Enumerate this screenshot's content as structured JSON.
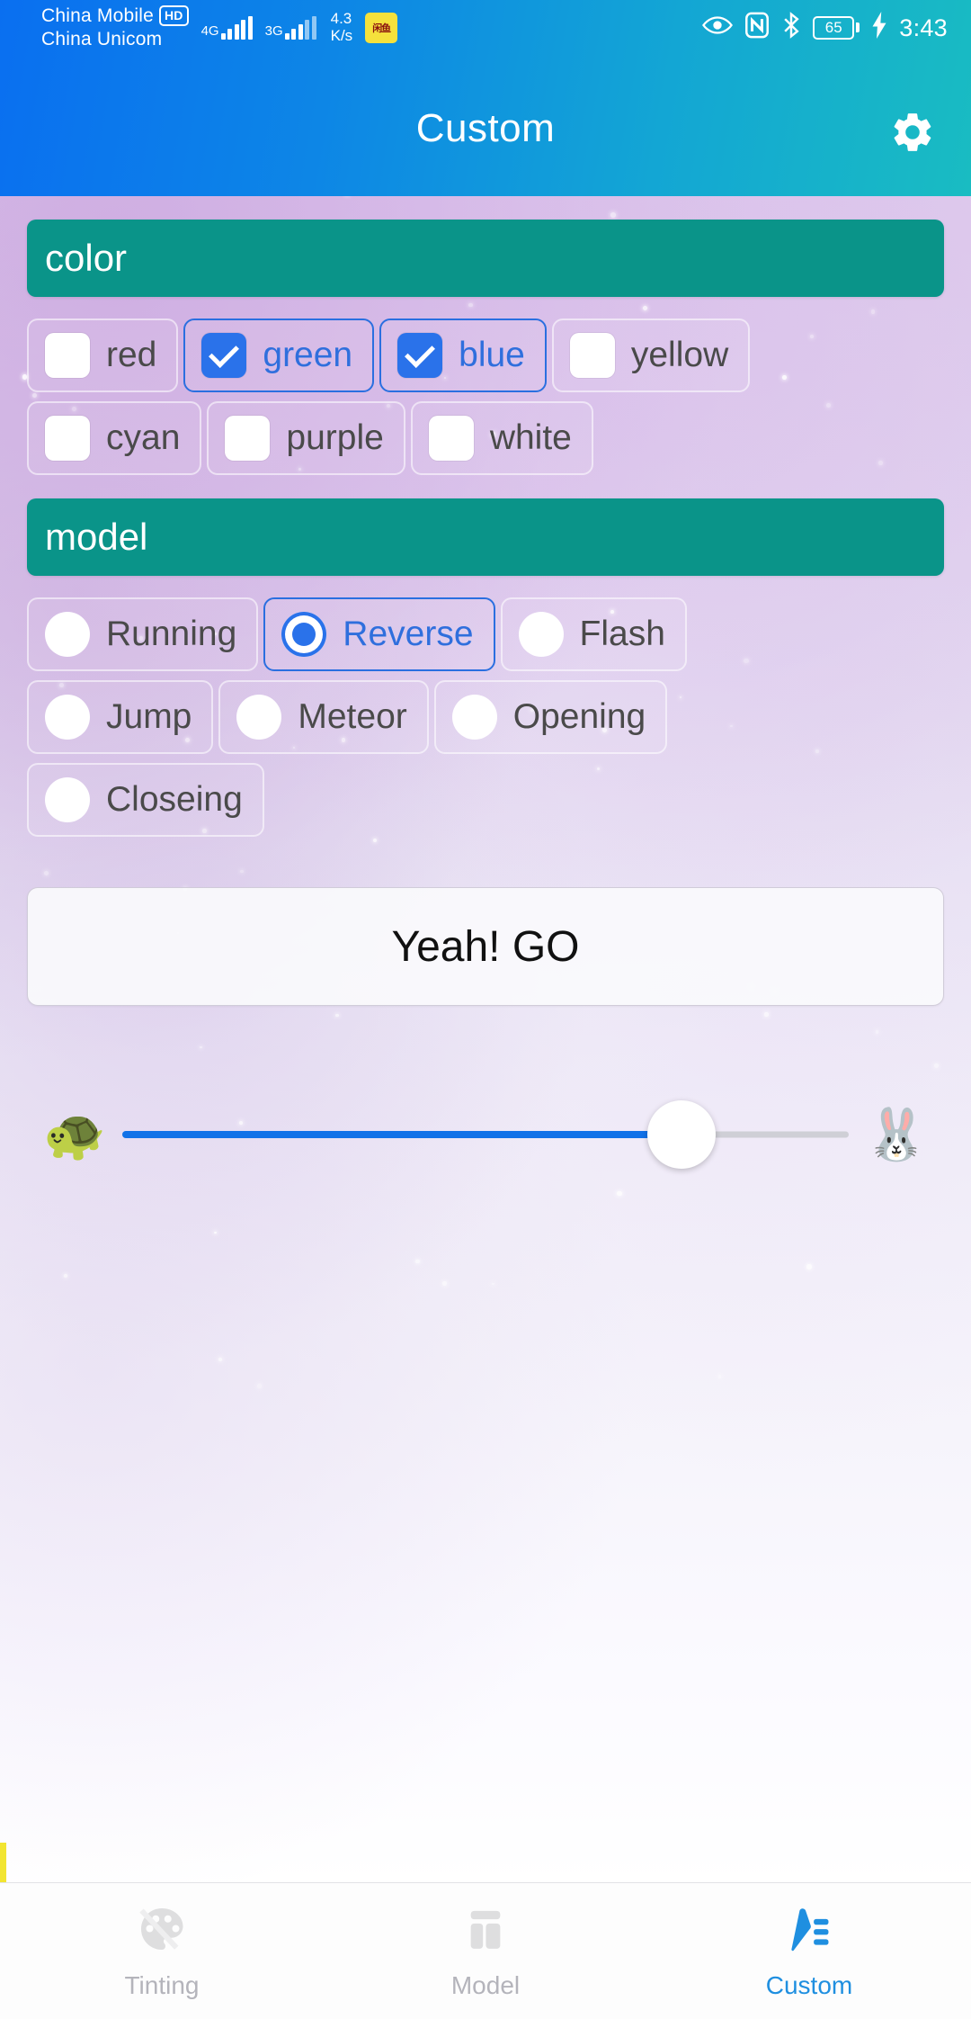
{
  "status_bar": {
    "carrier_primary": "China Mobile",
    "carrier_primary_badge": "HD",
    "carrier_secondary": "China Unicom",
    "signal_1_label": "4G",
    "signal_2_label": "3G",
    "net_speed_value": "4.3",
    "net_speed_unit": "K/s",
    "app_badge_text": "闲鱼",
    "eye_icon": "eye-icon",
    "nfc_icon": "nfc-icon",
    "bluetooth_icon": "bluetooth-icon",
    "battery_level": "65",
    "charging_icon": "lightning-bolt-icon",
    "clock": "3:43"
  },
  "header": {
    "title": "Custom",
    "settings_icon": "gear-icon",
    "gradient_start": "#0a6ff0",
    "gradient_end": "#19bcc2"
  },
  "color_section": {
    "header": "color",
    "header_color": "#0a9489",
    "accent_color": "#2a72ea",
    "options": [
      {
        "label": "red",
        "checked": false
      },
      {
        "label": "green",
        "checked": true
      },
      {
        "label": "blue",
        "checked": true
      },
      {
        "label": "yellow",
        "checked": false
      },
      {
        "label": "cyan",
        "checked": false
      },
      {
        "label": "purple",
        "checked": false
      },
      {
        "label": "white",
        "checked": false
      }
    ]
  },
  "model_section": {
    "header": "model",
    "header_color": "#0a9489",
    "accent_color": "#2a72ea",
    "options": [
      {
        "label": "Running",
        "selected": false
      },
      {
        "label": "Reverse",
        "selected": true
      },
      {
        "label": "Flash",
        "selected": false
      },
      {
        "label": "Jump",
        "selected": false
      },
      {
        "label": "Meteor",
        "selected": false
      },
      {
        "label": "Opening",
        "selected": false
      },
      {
        "label": "Closeing",
        "selected": false
      }
    ]
  },
  "go_button": {
    "label": "Yeah!  GO"
  },
  "speed_slider": {
    "left_icon": "turtle-icon",
    "left_glyph": "🐢",
    "right_icon": "rabbit-icon",
    "right_glyph": "🐰",
    "value_percent": 77,
    "fill_color": "#1272e8"
  },
  "bottom_nav": {
    "active_color": "#1f8fe0",
    "inactive_color": "#b4b4bb",
    "items": [
      {
        "label": "Tinting",
        "icon": "palette-icon",
        "active": false
      },
      {
        "label": "Model",
        "icon": "grid-icon",
        "active": false
      },
      {
        "label": "Custom",
        "icon": "pen-list-icon",
        "active": true
      }
    ]
  }
}
